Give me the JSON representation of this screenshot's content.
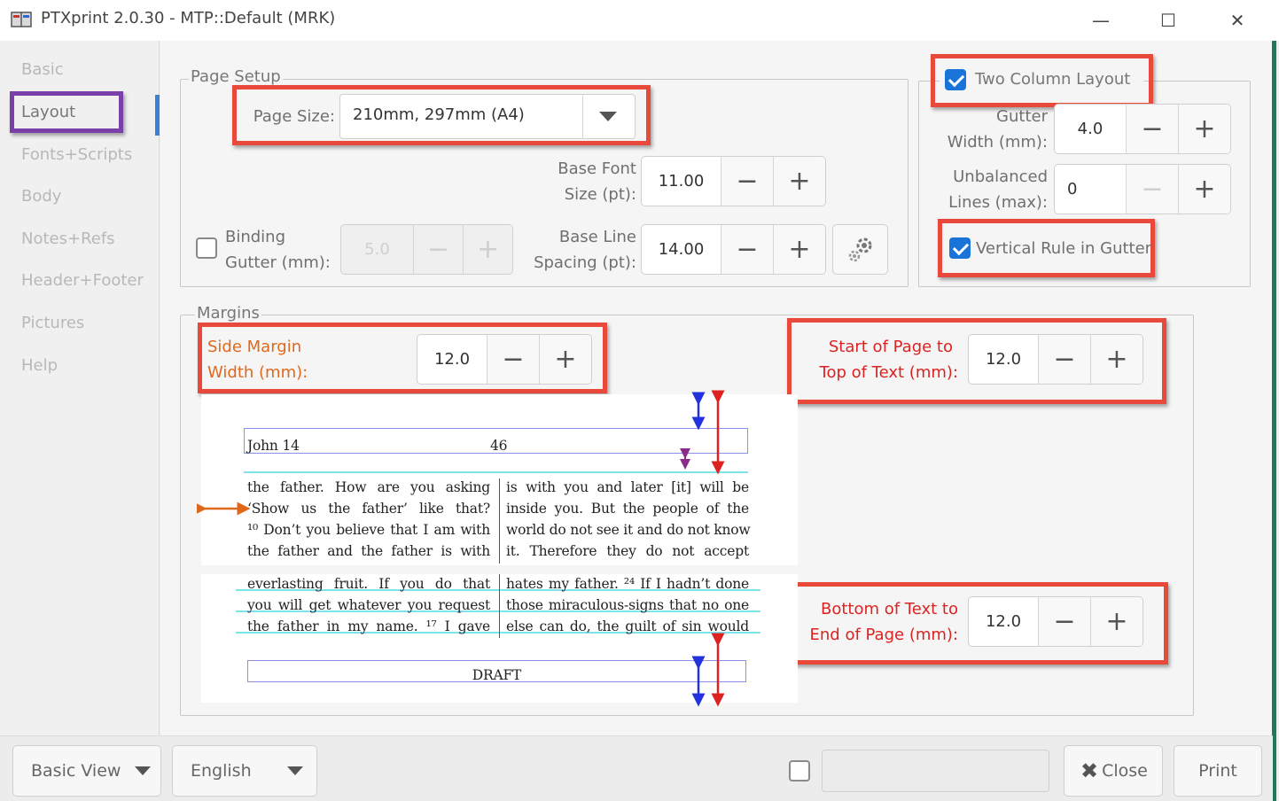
{
  "window": {
    "title": "PTXprint 2.0.30  -  MTP::Default  (MRK)",
    "minimize": "—",
    "maximize": "☐",
    "close": "✕"
  },
  "sidebar": {
    "items": [
      {
        "label": "Basic"
      },
      {
        "label": "Layout"
      },
      {
        "label": "Fonts+Scripts"
      },
      {
        "label": "Body"
      },
      {
        "label": "Notes+Refs"
      },
      {
        "label": "Header+Footer"
      },
      {
        "label": "Pictures"
      },
      {
        "label": "Help"
      }
    ],
    "active": "Layout"
  },
  "page_setup": {
    "legend": "Page Setup",
    "page_size_label": "Page Size:",
    "page_size_value": "210mm, 297mm (A4)",
    "base_font_label_1": "Base Font",
    "base_font_label_2": "Size (pt):",
    "base_font_value": "11.00",
    "binding_label_1": "Binding",
    "binding_label_2": "Gutter (mm):",
    "binding_value": "5.0",
    "binding_checked": false,
    "base_line_label_1": "Base Line",
    "base_line_label_2": "Spacing (pt):",
    "base_line_value": "14.00"
  },
  "two_column": {
    "legend": "Two Column Layout",
    "checked": true,
    "gutter_label_1": "Gutter",
    "gutter_label_2": "Width (mm):",
    "gutter_value": "4.0",
    "unbalanced_label_1": "Unbalanced",
    "unbalanced_label_2": "Lines (max):",
    "unbalanced_value": "0",
    "vertical_rule_label": "Vertical Rule in Gutter",
    "vertical_rule_checked": true
  },
  "margins": {
    "legend": "Margins",
    "side_label_1": "Side Margin",
    "side_label_2": "Width (mm):",
    "side_value": "12.0",
    "top_label_1": "Start of Page to",
    "top_label_2": "Top of Text (mm):",
    "top_value": "12.0",
    "bottom_label_1": "Bottom of Text to",
    "bottom_label_2": "End of Page (mm):",
    "bottom_value": "12.0"
  },
  "preview": {
    "header_left": "John 14",
    "header_center": "46",
    "left_col_top": [
      "the father. How are you asking",
      "‘Show us the father’ like that?",
      "¹⁰ Don’t you believe that I am with",
      "the father and the father is with"
    ],
    "right_col_top": [
      "is with you and later [it] will be",
      "inside you. But the people of the",
      "world do not see it and do not know",
      "it. Therefore they do not accept"
    ],
    "left_col_bottom": [
      "everlasting fruit. If you do that",
      "you will get whatever you request",
      "the father in my name. ¹⁷ I gave"
    ],
    "right_col_bottom": [
      "hates my father. ²⁴ If I hadn’t done",
      "those miraculous-signs that no one",
      "else can do, the guilt of sin would"
    ],
    "footer": "DRAFT"
  },
  "bottom_bar": {
    "view": "Basic View",
    "language": "English",
    "close": "Close",
    "print": "Print"
  },
  "colors": {
    "highlight_red": "#e8493a",
    "sidebar_highlight_purple": "#7a3fa8",
    "checkbox_blue": "#1a73d9",
    "label_red": "#dd2222",
    "label_orange": "#e0681c"
  }
}
